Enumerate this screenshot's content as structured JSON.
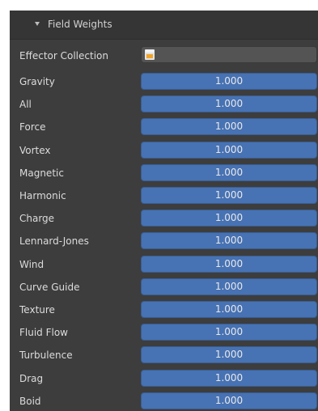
{
  "panel": {
    "title": "Field Weights",
    "effector_collection_label": "Effector Collection",
    "effector_collection_icon": "collection-icon"
  },
  "weights": [
    {
      "label": "Gravity",
      "value": "1.000"
    },
    {
      "label": "All",
      "value": "1.000"
    },
    {
      "label": "Force",
      "value": "1.000"
    },
    {
      "label": "Vortex",
      "value": "1.000"
    },
    {
      "label": "Magnetic",
      "value": "1.000"
    },
    {
      "label": "Harmonic",
      "value": "1.000"
    },
    {
      "label": "Charge",
      "value": "1.000"
    },
    {
      "label": "Lennard-Jones",
      "value": "1.000"
    },
    {
      "label": "Wind",
      "value": "1.000"
    },
    {
      "label": "Curve Guide",
      "value": "1.000"
    },
    {
      "label": "Texture",
      "value": "1.000"
    },
    {
      "label": "Fluid Flow",
      "value": "1.000"
    },
    {
      "label": "Turbulence",
      "value": "1.000"
    },
    {
      "label": "Drag",
      "value": "1.000"
    },
    {
      "label": "Boid",
      "value": "1.000"
    }
  ],
  "colors": {
    "panel_bg": "#3d3d3d",
    "header_bg": "#353535",
    "slider_fill": "#4772b3",
    "field_bg": "#545454",
    "text": "#dcdcdc"
  }
}
